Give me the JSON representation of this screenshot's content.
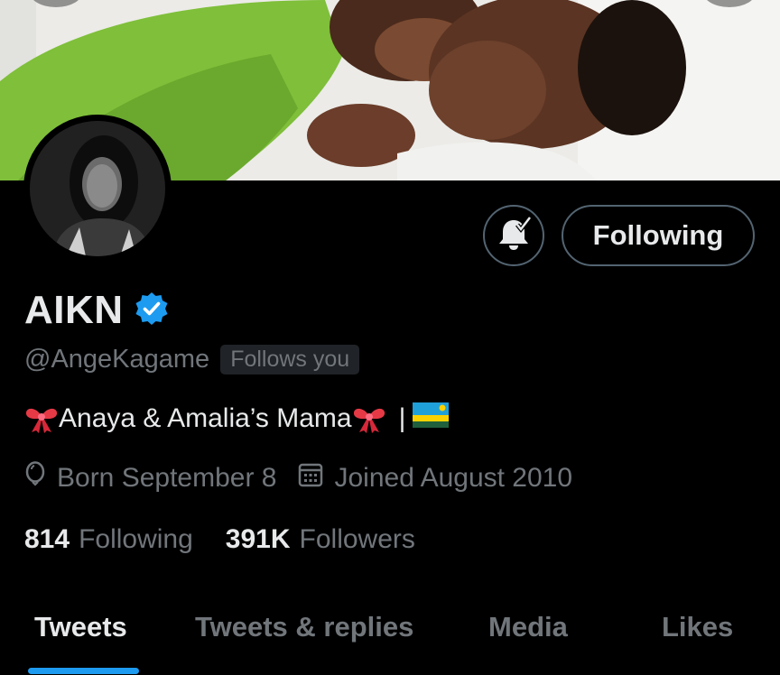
{
  "profile": {
    "name": "AIKN",
    "handle": "@AngeKagame",
    "follows_you": "Follows you",
    "bio_text": "Anaya & Amalia’s Mama",
    "bio_separator": "|",
    "born": "Born September 8",
    "joined": "Joined August 2010",
    "following_count": "814",
    "following_label": "Following",
    "followers_count": "391K",
    "followers_label": "Followers"
  },
  "actions": {
    "following_button": "Following"
  },
  "tabs": [
    {
      "label": "Tweets",
      "active": true
    },
    {
      "label": "Tweets & replies",
      "active": false
    },
    {
      "label": "Media",
      "active": false
    },
    {
      "label": "Likes",
      "active": false
    }
  ],
  "icons": {
    "verified": "verified-badge-icon",
    "bell": "bell-check-icon",
    "birthday": "balloon-icon",
    "joined": "calendar-icon",
    "bio_emoji": "ribbon-icon",
    "flag": "rwanda-flag-icon"
  },
  "colors": {
    "background": "#000000",
    "primary_text": "#e7e9ea",
    "secondary_text": "#71767b",
    "accent": "#1d9bf0",
    "border": "#536471"
  }
}
